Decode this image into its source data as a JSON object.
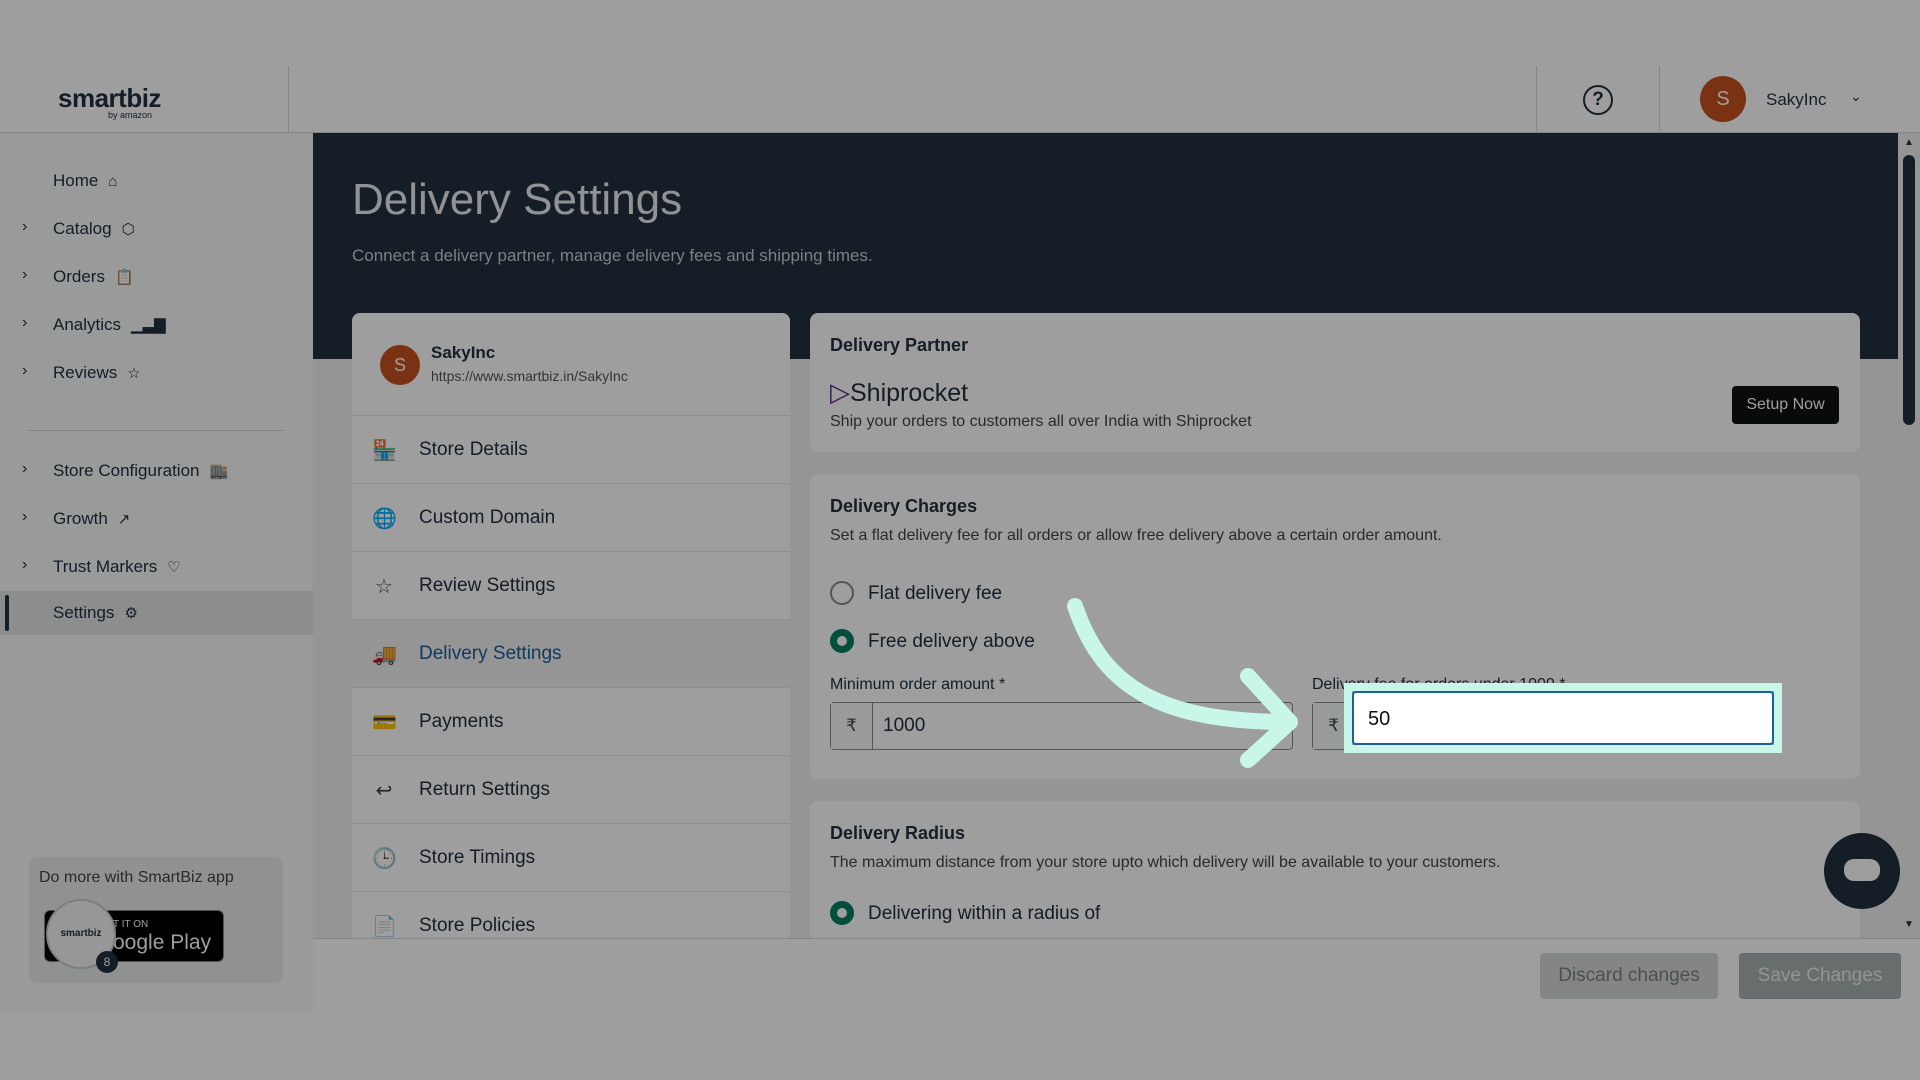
{
  "brand": {
    "name_a": "smart",
    "name_b": "biz",
    "by": "by amazon"
  },
  "topbar": {
    "help_icon": "question-circle-icon",
    "user_initial": "S",
    "user_name": "SakyInc"
  },
  "sidebar": {
    "items": [
      {
        "label": "Home",
        "icon": "⌂",
        "has_chevron": false
      },
      {
        "label": "Catalog",
        "icon": "⬡",
        "has_chevron": true
      },
      {
        "label": "Orders",
        "icon": "📋",
        "has_chevron": true
      },
      {
        "label": "Analytics",
        "icon": "▁▃▇",
        "has_chevron": true
      },
      {
        "label": "Reviews",
        "icon": "☆",
        "has_chevron": true
      },
      {
        "label": "Store Configuration",
        "icon": "🏬",
        "has_chevron": true
      },
      {
        "label": "Growth",
        "icon": "↗",
        "has_chevron": true
      },
      {
        "label": "Trust Markers",
        "icon": "♡",
        "has_chevron": true
      },
      {
        "label": "Settings",
        "icon": "⚙",
        "has_chevron": false,
        "active": true
      }
    ],
    "promo_text": "Do more with SmartBiz app",
    "gplay_small": "T IT ON",
    "gplay_big": "oogle Play",
    "app_badge": "smartbiz",
    "badge_count": "8"
  },
  "page": {
    "title": "Delivery Settings",
    "subtitle": "Connect a delivery partner, manage delivery fees and shipping times."
  },
  "store": {
    "initial": "S",
    "name": "SakyInc",
    "url": "https://www.smartbiz.in/SakyInc",
    "menu": [
      {
        "label": "Store Details",
        "icon": "🏪"
      },
      {
        "label": "Custom Domain",
        "icon": "🌐"
      },
      {
        "label": "Review Settings",
        "icon": "☆"
      },
      {
        "label": "Delivery Settings",
        "icon": "🚚",
        "active": true
      },
      {
        "label": "Payments",
        "icon": "💳"
      },
      {
        "label": "Return Settings",
        "icon": "↩"
      },
      {
        "label": "Store Timings",
        "icon": "🕒"
      },
      {
        "label": "Store Policies",
        "icon": "📄"
      }
    ]
  },
  "partner": {
    "title": "Delivery Partner",
    "logo_text": "Shiprocket",
    "desc": "Ship your orders to customers all over India with Shiprocket",
    "button": "Setup Now"
  },
  "charges": {
    "title": "Delivery Charges",
    "desc": "Set a flat delivery fee for all orders or allow free delivery above a certain order amount.",
    "option_flat": "Flat delivery fee",
    "option_free": "Free delivery above",
    "min_label": "Minimum order amount *",
    "currency": "₹",
    "min_value": "1000",
    "fee_label": "Delivery fee for orders under 1000 *",
    "fee_value": "50"
  },
  "radius": {
    "title": "Delivery Radius",
    "desc": "The maximum distance from your store upto which delivery will be available to your customers.",
    "option": "Delivering within a radius of"
  },
  "footer": {
    "discard": "Discard changes",
    "save": "Save Changes"
  },
  "colors": {
    "accent": "#067d62",
    "dark": "#232f3e",
    "link": "#1a5e9a",
    "highlight": "#c8f7ea"
  }
}
